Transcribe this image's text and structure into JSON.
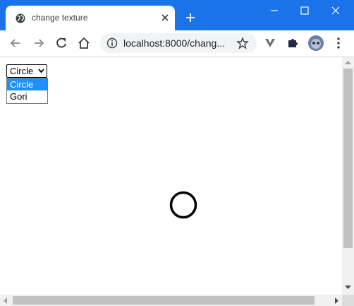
{
  "browser": {
    "tab_title": "change texture",
    "url": "localhost:8000/chang...",
    "theme_color": "#1a73e8"
  },
  "page": {
    "select": {
      "value": "Circle",
      "options": [
        "Circle",
        "Gori"
      ]
    },
    "accent_color": "#1e90ff"
  },
  "icons": [
    "globe-icon",
    "close-icon",
    "plus-icon",
    "minimize-icon",
    "maximize-icon",
    "back-icon",
    "forward-icon",
    "reload-icon",
    "home-icon",
    "info-icon",
    "star-icon",
    "extension-v-icon",
    "puzzle-icon",
    "menu-icon",
    "chevron-down-icon"
  ]
}
